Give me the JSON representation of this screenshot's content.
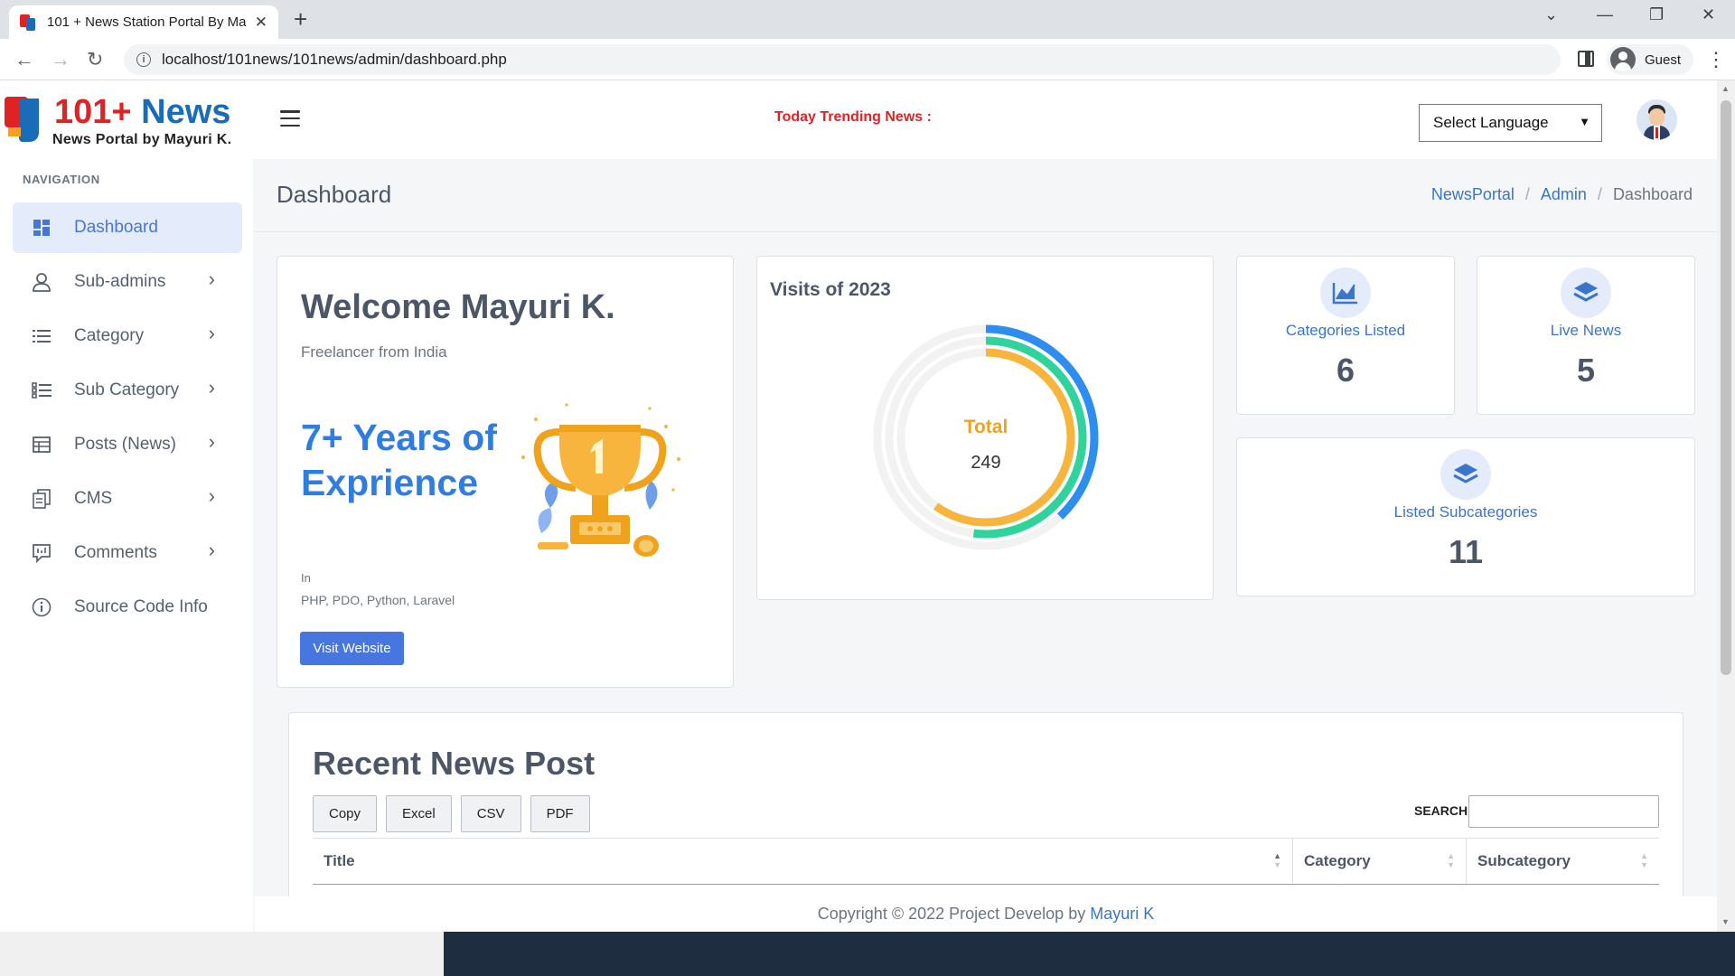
{
  "browser": {
    "tab_title": "101 + News Station Portal By Ma",
    "url": "localhost/101news/101news/admin/dashboard.php",
    "profile_name": "Guest"
  },
  "header": {
    "logo_part1": "101+",
    "logo_part2": "News",
    "logo_subtitle": "News Portal by Mayuri K.",
    "trending_label": "Today Trending News :",
    "language_select": "Select Language"
  },
  "sidebar": {
    "heading": "NAVIGATION",
    "items": [
      {
        "label": "Dashboard",
        "icon": "dashboard-icon",
        "active": true,
        "has_submenu": false
      },
      {
        "label": "Sub-admins",
        "icon": "user-icon",
        "has_submenu": true
      },
      {
        "label": "Category",
        "icon": "list-icon",
        "has_submenu": true
      },
      {
        "label": "Sub Category",
        "icon": "sublist-icon",
        "has_submenu": true
      },
      {
        "label": "Posts (News)",
        "icon": "table-icon",
        "has_submenu": true
      },
      {
        "label": "CMS",
        "icon": "documents-icon",
        "has_submenu": true
      },
      {
        "label": "Comments",
        "icon": "comment-icon",
        "has_submenu": true
      },
      {
        "label": "Source Code Info",
        "icon": "info-icon",
        "has_submenu": false
      }
    ]
  },
  "page": {
    "title": "Dashboard",
    "breadcrumb": [
      "NewsPortal",
      "Admin",
      "Dashboard"
    ]
  },
  "welcome": {
    "title": "Welcome Mayuri K.",
    "subtitle": "Freelancer from India",
    "years": "7+ Years of Exprience",
    "in_label": "In",
    "tech": "PHP, PDO, Python, Laravel",
    "button": "Visit Website"
  },
  "visits": {
    "title": "Visits of 2023",
    "center_label": "Total",
    "center_value": "249",
    "rings": [
      {
        "color": "#2e8ef0",
        "fraction": 0.38
      },
      {
        "color": "#2fd39b",
        "fraction": 0.52
      },
      {
        "color": "#f8b53e",
        "fraction": 0.6
      }
    ]
  },
  "stats": [
    {
      "label": "Categories Listed",
      "value": "6",
      "icon": "chart-icon"
    },
    {
      "label": "Live News",
      "value": "5",
      "icon": "layers-icon"
    },
    {
      "label": "Listed Subcategories",
      "value": "11",
      "icon": "layers-icon"
    }
  ],
  "recent": {
    "title": "Recent News Post",
    "buttons": [
      "Copy",
      "Excel",
      "CSV",
      "PDF"
    ],
    "search_label": "SEARCH:",
    "columns": [
      "Title",
      "Category",
      "Subcategory"
    ]
  },
  "footer": {
    "text": "Copyright © 2022 Project Develop by",
    "link": "Mayuri K"
  },
  "colors": {
    "accent": "#4876e0",
    "link": "#3b74c9",
    "brand_red": "#e02222",
    "brand_blue": "#1a6bb8"
  }
}
